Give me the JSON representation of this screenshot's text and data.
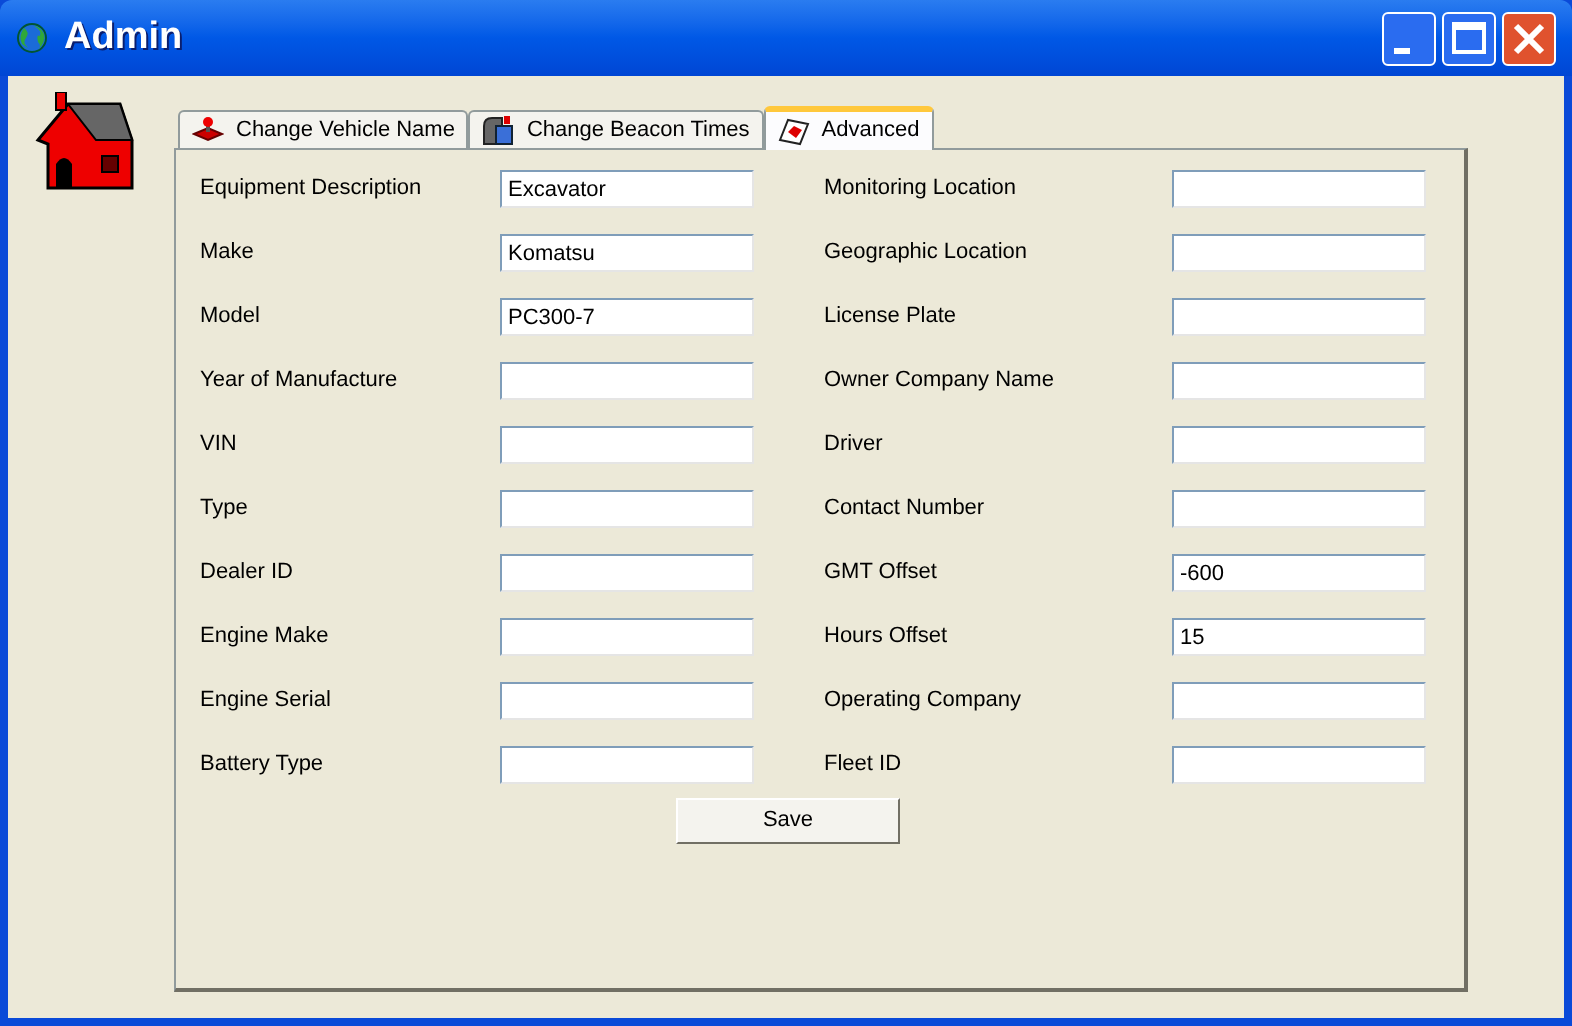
{
  "window": {
    "title": "Admin"
  },
  "tabs": [
    {
      "label": "Change Vehicle Name",
      "selected": false
    },
    {
      "label": "Change Beacon Times",
      "selected": false
    },
    {
      "label": "Advanced",
      "selected": true
    }
  ],
  "fields_left": [
    {
      "label": "Equipment Description",
      "value": "Excavator"
    },
    {
      "label": "Make",
      "value": "Komatsu"
    },
    {
      "label": "Model",
      "value": "PC300-7"
    },
    {
      "label": "Year of Manufacture"
    },
    {
      "label": "VIN"
    },
    {
      "label": "Type"
    },
    {
      "label": "Dealer ID"
    },
    {
      "label": "Engine Make"
    },
    {
      "label": "Engine Serial"
    },
    {
      "label": "Battery Type"
    }
  ],
  "fields_right": [
    {
      "label": "Monitoring Location"
    },
    {
      "label": "Geographic Location"
    },
    {
      "label": "License Plate"
    },
    {
      "label": "Owner Company Name"
    },
    {
      "label": "Driver"
    },
    {
      "label": "Contact Number"
    },
    {
      "label": "GMT Offset",
      "value": "-600"
    },
    {
      "label": "Hours Offset",
      "value": "15"
    },
    {
      "label": "Operating Company"
    },
    {
      "label": "Fleet ID"
    }
  ],
  "save_button": "Save"
}
